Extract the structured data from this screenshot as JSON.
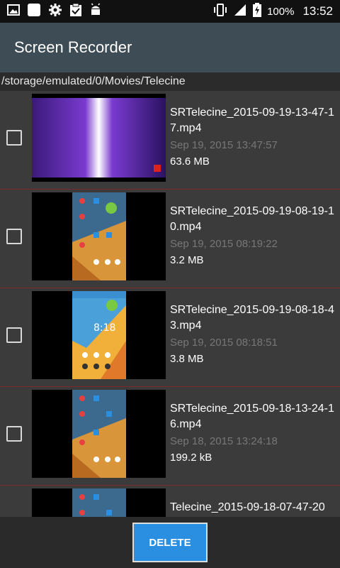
{
  "status": {
    "battery": "100%",
    "time": "13:52"
  },
  "app": {
    "title": "Screen Recorder"
  },
  "path": "/storage/emulated/0/Movies/Telecine",
  "items": [
    {
      "filename": "SRTelecine_2015-09-19-13-47-17.mp4",
      "date": "Sep 19, 2015 13:47:57",
      "size": "63.6 MB",
      "thumb": "purple"
    },
    {
      "filename": "SRTelecine_2015-09-19-08-19-10.mp4",
      "date": "Sep 19, 2015 08:19:22",
      "size": "3.2 MB",
      "thumb": "phone-home"
    },
    {
      "filename": "SRTelecine_2015-09-19-08-18-43.mp4",
      "date": "Sep 19, 2015 08:18:51",
      "size": "3.8 MB",
      "thumb": "phone-lock"
    },
    {
      "filename": "SRTelecine_2015-09-18-13-24-16.mp4",
      "date": "Sep 18, 2015 13:24:18",
      "size": "199.2 kB",
      "thumb": "phone-home"
    },
    {
      "filename": "Telecine_2015-09-18-07-47-20",
      "date": "",
      "size": "",
      "thumb": "phone-home"
    }
  ],
  "actions": {
    "delete_label": "DELETE"
  },
  "colors": {
    "app_bar": "#3e4d55",
    "delete_button": "#2a8fe0",
    "divider": "#7a2a2a"
  }
}
